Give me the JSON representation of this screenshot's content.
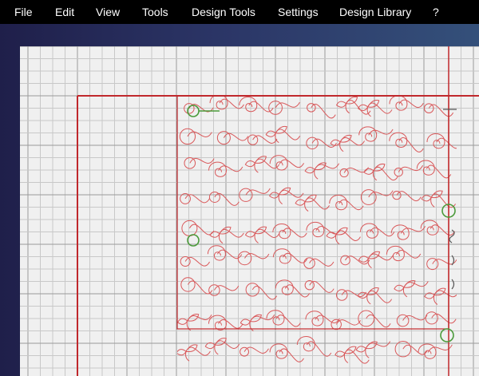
{
  "menu": {
    "items": [
      {
        "label": "File",
        "name": "menu-file"
      },
      {
        "label": "Edit",
        "name": "menu-edit"
      },
      {
        "label": "View",
        "name": "menu-view"
      },
      {
        "label": "Tools",
        "name": "menu-tools"
      },
      {
        "label": "Design Tools",
        "name": "menu-design-tools"
      },
      {
        "label": "Settings",
        "name": "menu-settings"
      },
      {
        "label": "Design Library",
        "name": "menu-design-library"
      },
      {
        "label": "?",
        "name": "menu-help"
      }
    ]
  },
  "colors": {
    "menubar": "#000000",
    "workspace": "#2b3566",
    "paper": "#f0f0f0",
    "grid_minor": "#c8c8c8",
    "grid_major": "#9a9a9a",
    "boundary_red": "#c0282c",
    "pattern_red": "#d9585a",
    "marker_green": "#4a9a3a"
  }
}
